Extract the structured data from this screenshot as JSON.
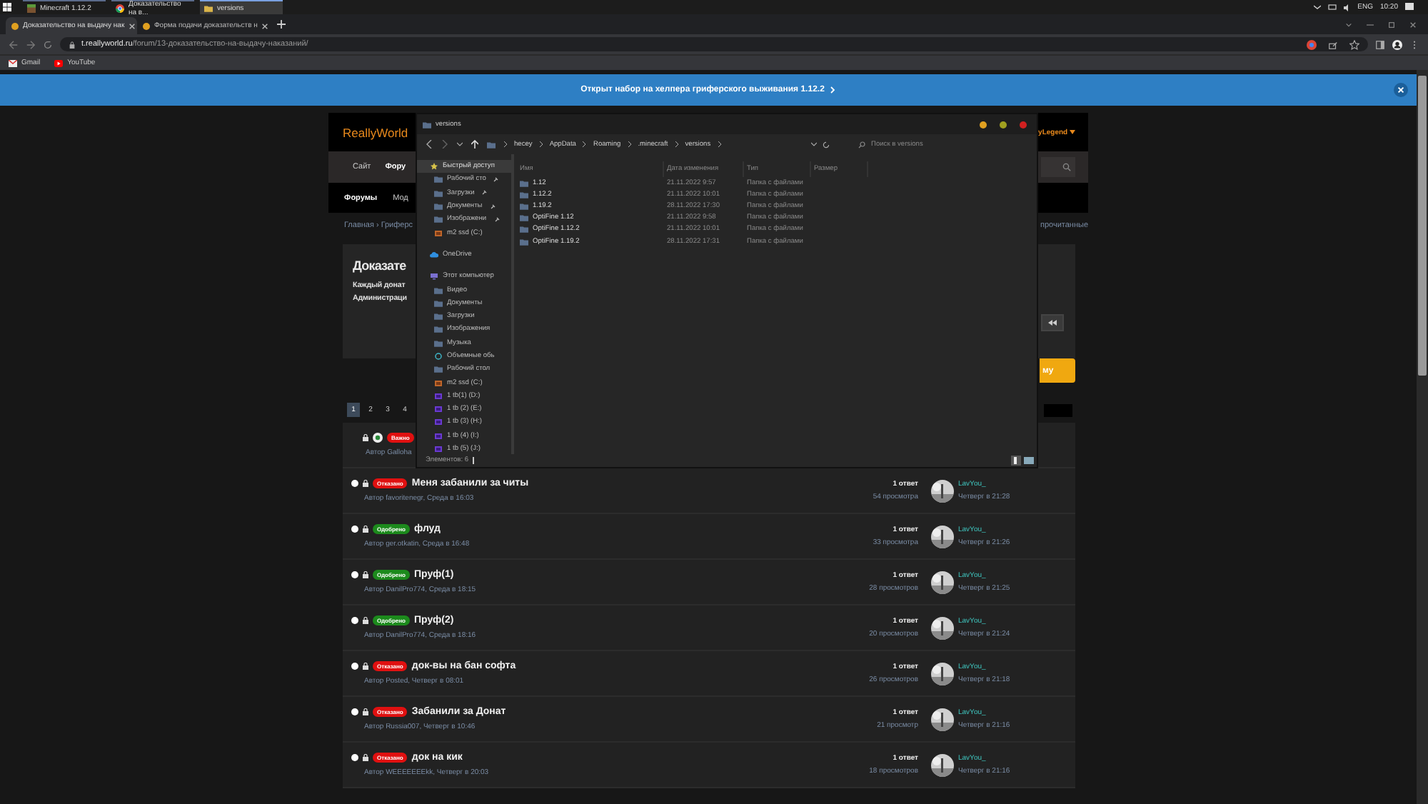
{
  "taskbar": {
    "items": [
      {
        "label": "Minecraft 1.12.2",
        "selected": false,
        "kind": "minecraft"
      },
      {
        "label": "Доказательство на в...",
        "selected": false,
        "kind": "browser"
      },
      {
        "label": "versions",
        "selected": true,
        "kind": "folder"
      }
    ],
    "language": "ENG",
    "time": "10:20"
  },
  "browser": {
    "tabs": [
      {
        "title": "Доказательство на выдачу нак",
        "selected": true
      },
      {
        "title": "Форма подачи доказательств н",
        "selected": false
      }
    ],
    "url_host": "t.reallyworld.ru",
    "url_path": "/forum/13-доказательство-на-выдачу-наказаний/",
    "bookmarks": [
      {
        "label": "Gmail",
        "kind": "gmail"
      },
      {
        "label": "YouTube",
        "kind": "youtube"
      }
    ]
  },
  "banner": {
    "text": "Открыт набор на хелпера гриферского выживания 1.12.2"
  },
  "forum": {
    "logo": "ReallyWorld",
    "user_menu": "yLegend",
    "nav": [
      {
        "label": "Сайт",
        "selected": false
      },
      {
        "label": "Фору",
        "selected": true
      }
    ],
    "subnav": [
      {
        "label": "Форумы",
        "selected": true
      },
      {
        "label": "Мод",
        "selected": false
      }
    ],
    "breadcrumb": "Главная › Гриферс",
    "unread_link": "прочитанные",
    "title": "Доказате",
    "description": [
      "Каждый донат",
      "Администраци"
    ],
    "new_topic_button": "му",
    "pages": [
      {
        "label": "1",
        "selected": true
      },
      {
        "label": "2",
        "selected": false
      },
      {
        "label": "3",
        "selected": false
      },
      {
        "label": "4",
        "selected": false
      }
    ],
    "pinned_topic": {
      "badge": "Важно",
      "author": "Автор Galloha"
    },
    "topics": [
      {
        "badge": {
          "label": "Отказано",
          "kind": "rejected"
        },
        "title": "Меня забанили за читы",
        "meta": "Автор favoritenegr, Среда в 16:03",
        "replies": "1 ответ",
        "views": "54 просмотра",
        "last_user": "LavYou_",
        "last_time": "Четверг в 21:28"
      },
      {
        "badge": {
          "label": "Одобрено",
          "kind": "approved"
        },
        "title": "флуд",
        "meta": "Автор ger.otkatin, Среда в 16:48",
        "replies": "1 ответ",
        "views": "33 просмотра",
        "last_user": "LavYou_",
        "last_time": "Четверг в 21:26"
      },
      {
        "badge": {
          "label": "Одобрено",
          "kind": "approved"
        },
        "title": "Пруф(1)",
        "meta": "Автор DanilPro774, Среда в 18:15",
        "replies": "1 ответ",
        "views": "28 просмотров",
        "last_user": "LavYou_",
        "last_time": "Четверг в 21:25"
      },
      {
        "badge": {
          "label": "Одобрено",
          "kind": "approved"
        },
        "title": "Пруф(2)",
        "meta": "Автор DanilPro774, Среда в 18:16",
        "replies": "1 ответ",
        "views": "20 просмотров",
        "last_user": "LavYou_",
        "last_time": "Четверг в 21:24"
      },
      {
        "badge": {
          "label": "Отказано",
          "kind": "rejected"
        },
        "title": "док-вы на бан софта",
        "meta": "Автор Posted, Четверг в 08:01",
        "replies": "1 ответ",
        "views": "26 просмотров",
        "last_user": "LavYou_",
        "last_time": "Четверг в 21:18"
      },
      {
        "badge": {
          "label": "Отказано",
          "kind": "rejected"
        },
        "title": "Забанили за Донат",
        "meta": "Автор Russia007, Четверг в 10:46",
        "replies": "1 ответ",
        "views": "21 просмотр",
        "last_user": "LavYou_",
        "last_time": "Четверг в 21:16"
      },
      {
        "badge": {
          "label": "Отказано",
          "kind": "rejected"
        },
        "title": "док на кик",
        "meta": "Автор WEEEEEEEkk, Четверг в 20:03",
        "replies": "1 ответ",
        "views": "18 просмотров",
        "last_user": "LavYou_",
        "last_time": "Четверг в 21:16"
      }
    ]
  },
  "explorer": {
    "title": "versions",
    "path": [
      "hecey",
      "AppData",
      "Roaming",
      ".minecraft",
      "versions"
    ],
    "search_placeholder": "Поиск в versions",
    "columns": [
      "Имя",
      "Дата изменения",
      "Тип",
      "Размер"
    ],
    "files": [
      {
        "name": "1.12",
        "modified": "21.11.2022 9:57",
        "type": "Папка с файлами"
      },
      {
        "name": "1.12.2",
        "modified": "21.11.2022 10:01",
        "type": "Папка с файлами"
      },
      {
        "name": "1.19.2",
        "modified": "28.11.2022 17:30",
        "type": "Папка с файлами"
      },
      {
        "name": "OptiFine 1.12",
        "modified": "21.11.2022 9:58",
        "type": "Папка с файлами"
      },
      {
        "name": "OptiFine 1.12.2",
        "modified": "21.11.2022 10:01",
        "type": "Папка с файлами"
      },
      {
        "name": "OptiFine 1.19.2",
        "modified": "28.11.2022 17:31",
        "type": "Папка с файлами"
      }
    ],
    "sidebar": [
      {
        "label": "Быстрый доступ",
        "kind": "star",
        "pinned": false,
        "selected": true
      },
      {
        "label": "Рабочий сто",
        "kind": "folder",
        "pinned": true,
        "selected": false
      },
      {
        "label": "Загрузки",
        "kind": "folder",
        "pinned": true,
        "selected": false
      },
      {
        "label": "Документы",
        "kind": "folder",
        "pinned": true,
        "selected": false
      },
      {
        "label": "Изображени",
        "kind": "folder",
        "pinned": true,
        "selected": false
      },
      {
        "label": "m2 ssd (C:)",
        "kind": "drive",
        "pinned": false,
        "selected": false
      },
      {
        "label": "OneDrive",
        "kind": "cloud",
        "pinned": false,
        "selected": false
      },
      {
        "label": "Этот компьютер",
        "kind": "pc",
        "pinned": false,
        "selected": false
      },
      {
        "label": "Видео",
        "kind": "folder",
        "pinned": false,
        "selected": false
      },
      {
        "label": "Документы",
        "kind": "folder",
        "pinned": false,
        "selected": false
      },
      {
        "label": "Загрузки",
        "kind": "folder",
        "pinned": false,
        "selected": false
      },
      {
        "label": "Изображения",
        "kind": "folder",
        "pinned": false,
        "selected": false
      },
      {
        "label": "Музыка",
        "kind": "folder",
        "pinned": false,
        "selected": false
      },
      {
        "label": "Объемные обь",
        "kind": "cube",
        "pinned": false,
        "selected": false
      },
      {
        "label": "Рабочий стол",
        "kind": "folder",
        "pinned": false,
        "selected": false
      },
      {
        "label": "m2 ssd (C:)",
        "kind": "drive",
        "pinned": false,
        "selected": false
      },
      {
        "label": "1 tb(1) (D:)",
        "kind": "usb",
        "pinned": false,
        "selected": false
      },
      {
        "label": "1 tb (2) (E:)",
        "kind": "usb",
        "pinned": false,
        "selected": false
      },
      {
        "label": "1 tb (3) (H:)",
        "kind": "usb",
        "pinned": false,
        "selected": false
      },
      {
        "label": "1 tb (4) (I:)",
        "kind": "usb",
        "pinned": false,
        "selected": false
      },
      {
        "label": "1 tb (5) (J:)",
        "kind": "usb",
        "pinned": false,
        "selected": false
      }
    ],
    "status": "Элементов: 6"
  }
}
